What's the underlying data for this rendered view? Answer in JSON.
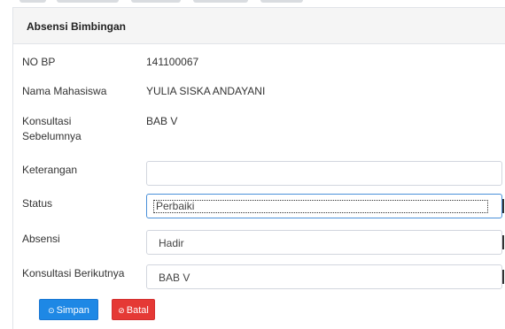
{
  "panel": {
    "title": "Absensi Bimbingan"
  },
  "fields": {
    "no_bp": {
      "label": "NO BP",
      "value": "141100067"
    },
    "nama": {
      "label": "Nama Mahasiswa",
      "value": "YULIA SISKA ANDAYANI"
    },
    "konsultasi_sebelumnya": {
      "label_line1": "Konsultasi",
      "label_line2": "Sebelumnya",
      "value": "BAB V"
    },
    "keterangan": {
      "label": "Keterangan",
      "value": "",
      "placeholder": ""
    },
    "status": {
      "label": "Status",
      "selected": "Perbaiki"
    },
    "absensi": {
      "label": "Absensi",
      "selected": "Hadir"
    },
    "konsultasi_berikutnya": {
      "label": "Konsultasi Berikutnya",
      "selected": "BAB V"
    }
  },
  "buttons": {
    "simpan": {
      "icon": "check-circle-icon",
      "glyph": "⊙",
      "label": "Simpan"
    },
    "batal": {
      "icon": "ban-icon",
      "glyph": "⊘",
      "label": "Batal"
    }
  },
  "colors": {
    "primary": "#1e88e5",
    "danger": "#e53935",
    "focus": "#4a90d9"
  }
}
